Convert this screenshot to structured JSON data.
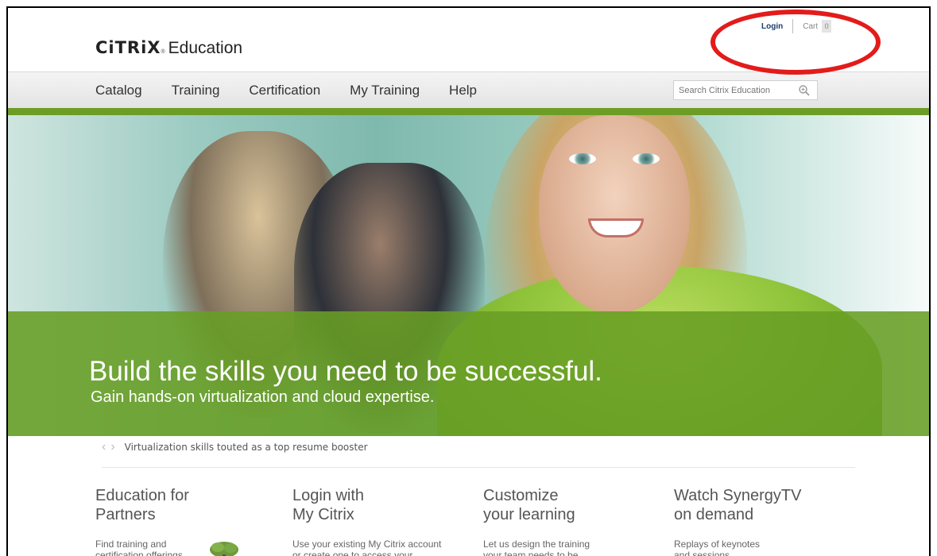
{
  "header": {
    "logo_mark": "CiTRiX",
    "logo_reg": "®",
    "logo_text": "Education",
    "login_label": "Login",
    "cart_label": "Cart",
    "cart_count": "0"
  },
  "nav": {
    "items": [
      "Catalog",
      "Training",
      "Certification",
      "My Training",
      "Help"
    ]
  },
  "search": {
    "placeholder": "Search Citrix Education",
    "icon": "search-icon"
  },
  "hero": {
    "title": "Build the skills you need to be successful.",
    "subtitle": "Gain hands-on virtualization and cloud expertise."
  },
  "ticker": {
    "prev_arrow": "‹",
    "next_arrow": "›",
    "text": "Virtualization skills touted as a top resume booster"
  },
  "features": [
    {
      "title": "Education for\nPartners",
      "text": "Find training and\ncertification offerings"
    },
    {
      "title": "Login with\nMy Citrix",
      "text": "Use your existing My Citrix account\nor create one to access your"
    },
    {
      "title": "Customize\nyour learning",
      "text": "Let us design the training\nyour team needs to be"
    },
    {
      "title": "Watch SynergyTV\non demand",
      "text": "Replays of keynotes\nand sessions"
    }
  ],
  "colors": {
    "brand_green": "#6c9d25",
    "annotation_red": "#e31b1b",
    "login_blue": "#1a3e6e"
  }
}
